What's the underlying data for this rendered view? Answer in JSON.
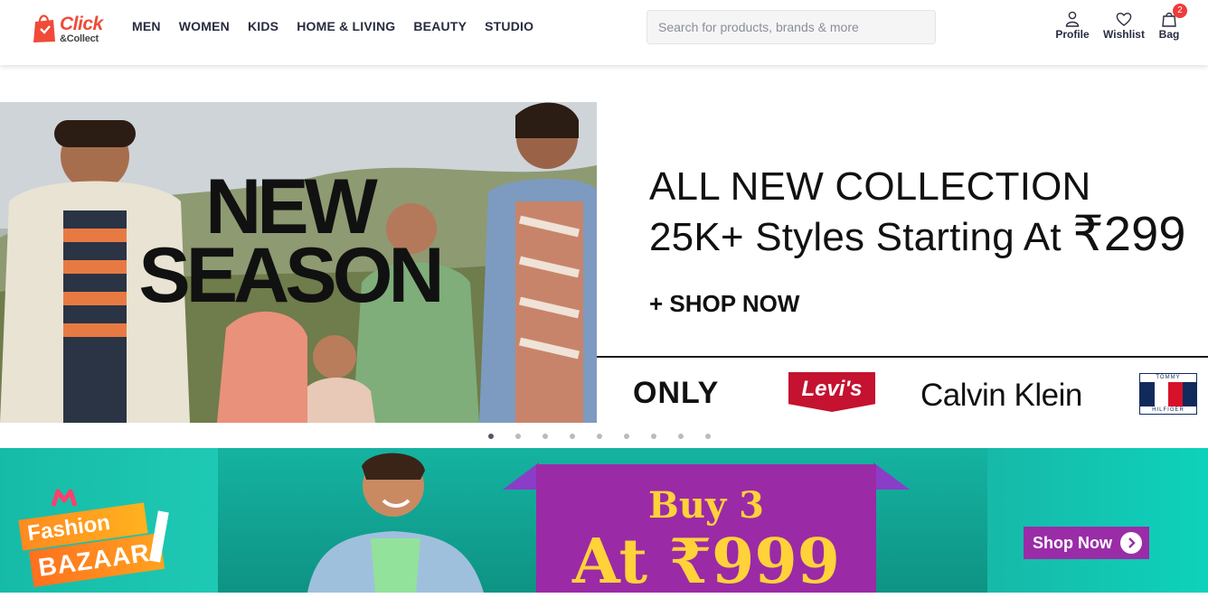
{
  "header": {
    "logo": {
      "line1": "Click",
      "line2": "&Collect"
    },
    "nav": [
      "MEN",
      "WOMEN",
      "KIDS",
      "HOME & LIVING",
      "BEAUTY",
      "STUDIO"
    ],
    "search": {
      "placeholder": "Search for products, brands & more"
    },
    "actions": {
      "profile": "Profile",
      "wishlist": "Wishlist",
      "bag": "Bag",
      "bag_count": "2"
    }
  },
  "hero": {
    "image_text_line1": "NEW",
    "image_text_line2": "SEASON",
    "headline_line1": "ALL NEW COLLECTION",
    "headline_line2_prefix": "25K+ Styles Starting At ",
    "headline_price": "₹299",
    "cta": "+ SHOP NOW",
    "brands": [
      "ONLY",
      "Levi's",
      "Calvin Klein",
      "TOMMY",
      "HILFIGER"
    ]
  },
  "carousel": {
    "total_dots": 9,
    "active_index": 0
  },
  "banner": {
    "badge_line1": "Fashion",
    "badge_line2": "BAZAAR",
    "offer_line1": "Buy 3",
    "offer_line2": "At ₹999",
    "cta": "Shop Now"
  },
  "colors": {
    "brand": "#ef4b38",
    "badge": "#ef3b3b",
    "banner_purple": "#9a2ca8",
    "banner_teal": "#16bba7"
  }
}
